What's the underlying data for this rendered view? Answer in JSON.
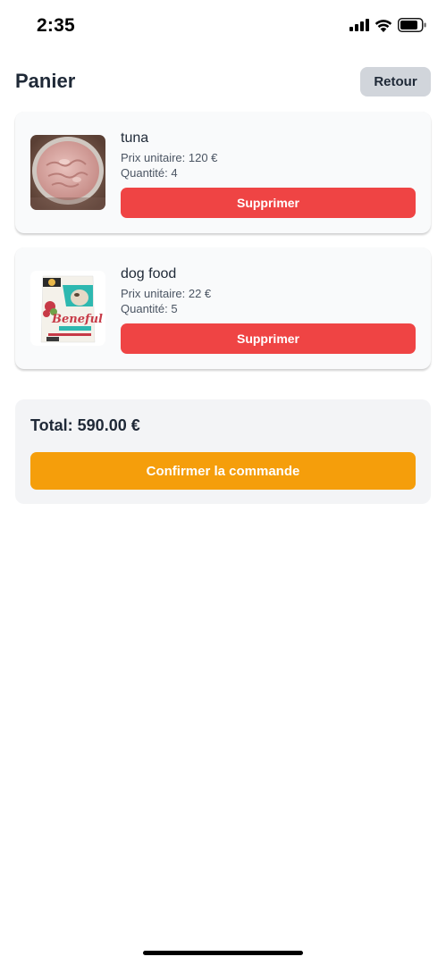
{
  "status_bar": {
    "time": "2:35",
    "icons": [
      "cellular-signal-icon",
      "wifi-icon",
      "battery-icon"
    ]
  },
  "header": {
    "title": "Panier",
    "back_label": "Retour"
  },
  "cart": {
    "items": [
      {
        "name": "tuna",
        "price": "Prix unitaire: 120 €",
        "quantity": "Quantité: 4",
        "remove_label": "Supprimer",
        "image": "tuna-product-image"
      },
      {
        "name": "dog food",
        "price": "Prix unitaire: 22 €",
        "quantity": "Quantité: 5",
        "remove_label": "Supprimer",
        "image": "dog-food-product-image"
      }
    ]
  },
  "summary": {
    "total": "Total: 590.00 €",
    "confirm_label": "Confirmer la commande"
  },
  "colors": {
    "danger": "#ef4444",
    "accent": "#f59e0b",
    "secondary_button": "#d1d5db",
    "card_background": "#f9fafb",
    "summary_background": "#f3f4f6",
    "text": "#1f2937",
    "muted_text": "#4b5563"
  }
}
